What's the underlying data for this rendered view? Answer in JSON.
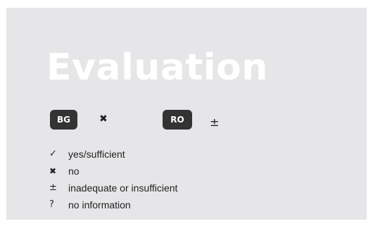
{
  "title": "Evaluation",
  "countries": [
    {
      "code": "BG",
      "mark": "✖"
    },
    {
      "code": "RO",
      "mark": "±"
    }
  ],
  "legend": [
    {
      "symbol": "✓",
      "icon": "check-icon",
      "label": "yes/sufficient"
    },
    {
      "symbol": "✖",
      "icon": "cross-icon",
      "label": "no"
    },
    {
      "symbol": "±",
      "icon": "plus-minus-icon",
      "label": "inadequate or insufficient"
    },
    {
      "symbol": "?",
      "icon": "question-icon",
      "label": "no information"
    }
  ],
  "colors": {
    "panel": "#e6e6e8",
    "badge": "#333333",
    "title": "#ffffff"
  }
}
